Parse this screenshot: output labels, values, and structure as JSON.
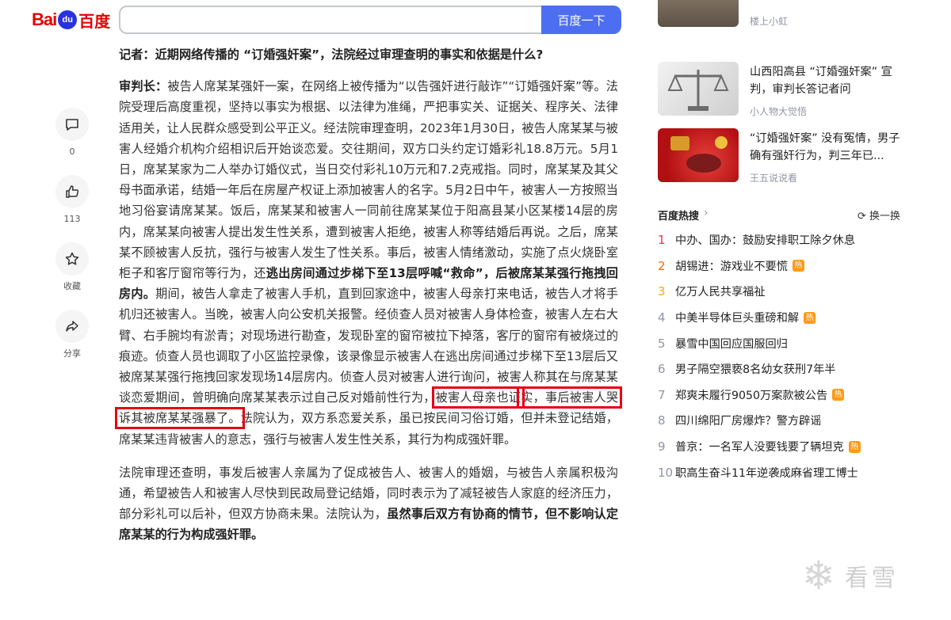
{
  "header": {
    "logo_bai": "Bai",
    "logo_du": "du",
    "logo_cn": "百度",
    "search_value": "",
    "search_button": "百度一下"
  },
  "actions": {
    "comment_count": "0",
    "like_count": "113",
    "favorite_label": "收藏",
    "share_label": "分享"
  },
  "article": {
    "question": "记者：近期网络传播的 “订婚强奸案”，法院经过审理查明的事实和依据是什么?",
    "p1_speaker": "审判长：",
    "p1_a": "被告人席某某强奸一案，在网络上被传播为“以告强奸进行敲诈”“订婚强奸案”等。法院受理后高度重视，坚持以事实为根据、以法律为准绳，严把事实关、证据关、程序关、法律适用关，让人民群众感受到公平正义。经法院审理查明，2023年1月30日，被告人席某某与被害人经婚介机构介绍相识后开始谈恋爱。交往期间，双方口头约定订婚彩礼18.8万元。5月1日，席某某家为二人举办订婚仪式，当日交付彩礼10万元和7.2克戒指。同时，席某某及其父母书面承诺，结婚一年后在房屋产权证上添加被害人的名字。5月2日中午，被害人一方按照当地习俗宴请席某某。饭后，席某某和被害人一同前往席某某位于阳高县某小区某楼14层的房内，席某某向被害人提出发生性关系，遭到被害人拒绝，被害人称等结婚后再说。之后，席某某不顾被害人反抗，强行与被害人发生了性关系。事后，被害人情绪激动，实施了点火烧卧室柜子和客厅窗帘等行为，还",
    "p1_bold": "逃出房间通过步梯下至13层呼喊“救命”，后被席某某强行拖拽回房内。",
    "p1_b": "期间，被告人拿走了被害人手机，直到回家途中，被害人母亲打来电话，被告人才将手机归还被害人。当晚，被害人向公安机关报警。经侦查人员对被害人身体检查，被害人左右大臂、右手腕均有淤青；对现场进行勘查，发现卧室的窗帘被拉下掉落，客厅的窗帘有被烧过的痕迹。侦查人员也调取了小区监控录像，该录像显示被害人在逃出房间通过步梯下至13层后又被席某某强行拖拽回家发现场14层房内。侦查人员对被害人进行询问，被害人称其在与席某某谈恋爱期间，曾明确向席某某表示过自己反对婚前性行为，",
    "p1_box1": "被害人母亲也证",
    "p1_box2": "实，事后被害人哭诉其被席某某强暴了。",
    "p1_c": "法院认为，双方系恋爱关系，虽已按民间习俗订婚，但并未登记结婚，席某某违背被害人的意志，强行与被害人发生性关系，其行为构成强奸罪。",
    "p2_a": "法院审理还查明，事发后被害人亲属为了促成被告人、被害人的婚姻，与被告人亲属积极沟通，希望被告人和被害人尽快到民政局登记结婚，同时表示为了减轻被告人家庭的经济压力，部分彩礼可以后补，但双方协商未果。法院认为，",
    "p2_bold": "虽然事后双方有协商的情节，但不影响认定席某某的行为构成强奸罪。"
  },
  "related": [
    {
      "title": "",
      "source": "楼上小虹"
    },
    {
      "title": "山西阳高县 “订婚强奸案” 宣判，审判长答记者问",
      "source": "小人物大觉悟"
    },
    {
      "title": "“订婚强奸案” 没有冤情，男子确有强奸行为，判三年已...",
      "source": "王五说说看"
    }
  ],
  "hot": {
    "title": "百度热搜",
    "refresh": "换一换",
    "badge": "热",
    "items": [
      {
        "rank": "1",
        "text": "中办、国办：鼓励安排职工除夕休息",
        "hot": false
      },
      {
        "rank": "2",
        "text": "胡锡进：游戏业不要慌",
        "hot": true
      },
      {
        "rank": "3",
        "text": "亿万人民共享福祉",
        "hot": false
      },
      {
        "rank": "4",
        "text": "中美半导体巨头重磅和解",
        "hot": true
      },
      {
        "rank": "5",
        "text": "暴雪中国回应国服回归",
        "hot": false
      },
      {
        "rank": "6",
        "text": "男子隔空猥亵8名幼女获刑7年半",
        "hot": false
      },
      {
        "rank": "7",
        "text": "郑爽未履行9050万案款被公告",
        "hot": true
      },
      {
        "rank": "8",
        "text": "四川绵阳厂房爆炸？警方辟谣",
        "hot": false
      },
      {
        "rank": "9",
        "text": "普京：一名军人没要钱要了辆坦克",
        "hot": true
      },
      {
        "rank": "10",
        "text": "职高生奋斗11年逆袭成麻省理工博士",
        "hot": false
      }
    ]
  },
  "watermark": "看雪",
  "colors": {
    "brand_red": "#e10602",
    "brand_blue": "#2932e1",
    "search_blue": "#4e6ef2",
    "highlight_red": "#e60012"
  }
}
